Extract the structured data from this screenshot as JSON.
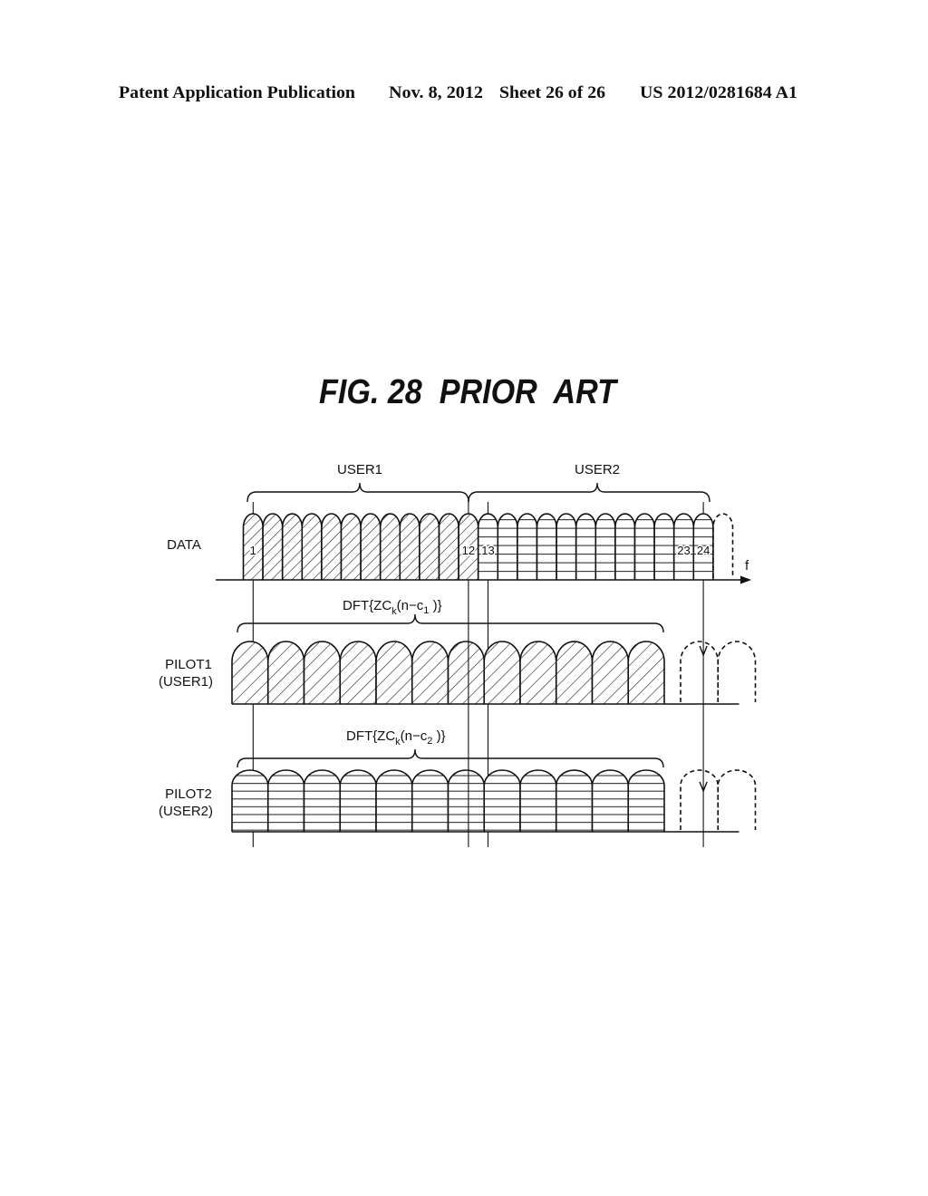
{
  "header": {
    "publication": "Patent Application Publication",
    "date": "Nov. 8, 2012",
    "sheet": "Sheet 26 of 26",
    "patent_number": "US 2012/0281684 A1"
  },
  "figure": {
    "title": "FIG. 28  PRIOR  ART"
  },
  "diagram": {
    "axis_label": "f",
    "data_row": {
      "label": "DATA",
      "subcarrier_count": 24,
      "extra_dashed_subcarriers": 1,
      "users": [
        {
          "name": "USER1",
          "first_subcarrier": 1,
          "last_subcarrier": 12,
          "hatch": "diagonal"
        },
        {
          "name": "USER2",
          "first_subcarrier": 13,
          "last_subcarrier": 24,
          "hatch": "horizontal"
        }
      ],
      "numbered_subcarriers": [
        "1",
        "12",
        "13",
        "23",
        "24"
      ]
    },
    "pilot_rows": [
      {
        "label_line1": "PILOT1",
        "label_line2": "(USER1)",
        "formula": {
          "prefix": "DFT{ZC",
          "sub_k": "k",
          "middle": "(n−c",
          "sub_c": "1",
          "suffix": " )}"
        },
        "subcarrier_count": 12,
        "extra_dashed_subcarriers": 2,
        "hatch": "diagonal"
      },
      {
        "label_line1": "PILOT2",
        "label_line2": "(USER2)",
        "formula": {
          "prefix": "DFT{ZC",
          "sub_k": "k",
          "middle": "(n−c",
          "sub_c": "2",
          "suffix": " )}"
        },
        "subcarrier_count": 12,
        "extra_dashed_subcarriers": 2,
        "hatch": "horizontal"
      }
    ],
    "mapping_lines_at_data_subcarriers": [
      1,
      12,
      13,
      24
    ],
    "arrow_at_data_subcarrier": 24
  }
}
